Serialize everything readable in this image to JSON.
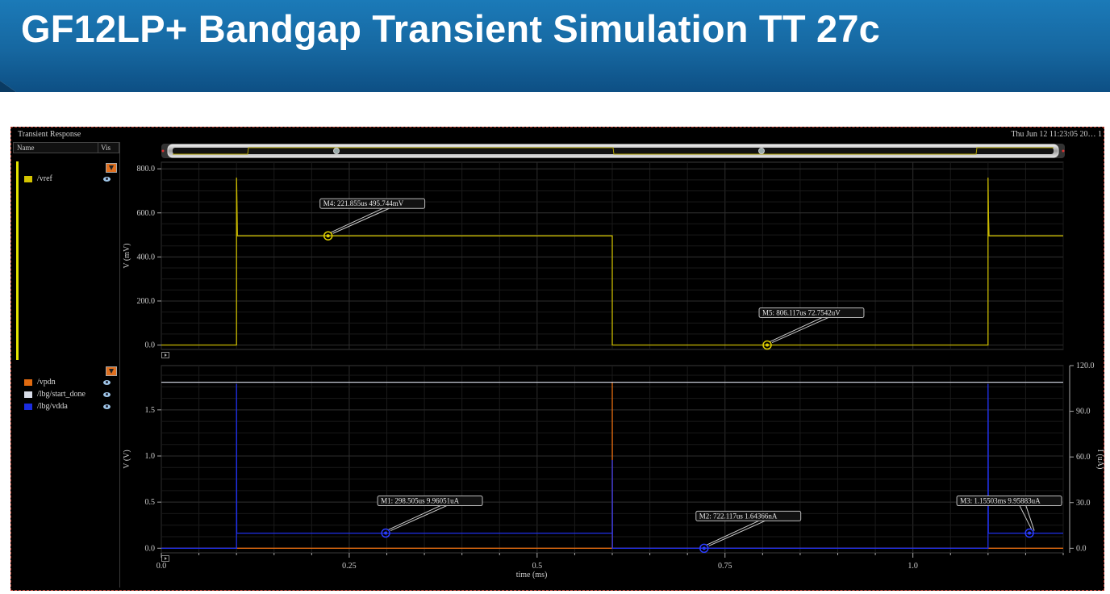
{
  "slide": {
    "title": "GF12LP+ Bandgap Transient Simulation TT 27c",
    "banner_color": "#1a6fa8"
  },
  "window": {
    "title": "Transient Response",
    "datetime": "Thu Jun 12 11:23:05 20…  1",
    "legend_header": {
      "name": "Name",
      "vis": "Vis"
    }
  },
  "top_legend": [
    {
      "name": "/vref",
      "color": "#d4c400"
    }
  ],
  "bottom_legend": [
    {
      "name": "/vpdn",
      "color": "#e06a10"
    },
    {
      "name": "/lbg/start_done",
      "color": "#d8dce8"
    },
    {
      "name": "/lbg/vdda",
      "color": "#1a2ce0"
    }
  ],
  "chart_data": [
    {
      "type": "line",
      "title": "",
      "xlabel": "",
      "ylabel": "V (mV)",
      "xlim": [
        0,
        1.2
      ],
      "ylim": [
        -20,
        830
      ],
      "yticks": [
        0.0,
        200.0,
        400.0,
        600.0,
        800.0
      ],
      "ytick_labels": [
        "0.0",
        "200.0",
        "400.0",
        "600.0",
        "800.0"
      ],
      "grid": true,
      "series": [
        {
          "name": "/vref",
          "color": "#c8b800",
          "x": [
            0,
            0.1,
            0.1,
            0.1006,
            0.1012,
            0.6,
            0.6,
            1.1,
            1.1,
            1.1006,
            1.1012,
            1.2
          ],
          "y": [
            0,
            0,
            760,
            650,
            495.7,
            495.7,
            0,
            0,
            760,
            580,
            495.7,
            495.7
          ]
        }
      ],
      "markers": [
        {
          "label": "M4: 221.855us 495.744mV",
          "x": 0.221855,
          "y": 495.744
        },
        {
          "label": "M5: 806.117us 72.7542uV",
          "x": 0.806117,
          "y": 0.0728
        }
      ]
    },
    {
      "type": "line",
      "title": "",
      "xlabel": "time (ms)",
      "ylabel": "V (V)",
      "ylabel_right": "I (uA)",
      "xlim": [
        0,
        1.2
      ],
      "xticks": [
        0.0,
        0.25,
        0.5,
        0.75,
        1.0
      ],
      "xtick_labels": [
        "0.0",
        "0.25",
        "0.5",
        "0.75",
        "1.0"
      ],
      "ylim": [
        -0.05,
        1.98
      ],
      "yticks": [
        0.0,
        0.5,
        1.0,
        1.5
      ],
      "ytick_labels": [
        "0.0",
        "0.5",
        "1.0",
        "1.5"
      ],
      "ylim_right": [
        -3,
        120
      ],
      "yticks_right": [
        0.0,
        30.0,
        60.0,
        90.0,
        120.0
      ],
      "ytick_labels_right": [
        "0.0",
        "30.0",
        "60.0",
        "90.0",
        "120.0"
      ],
      "grid": true,
      "series": [
        {
          "name": "/vpdn",
          "axis": "left",
          "color": "#e06a10",
          "x": [
            0,
            0.6,
            0.6,
            0.6002,
            1.2
          ],
          "y": [
            0,
            0,
            1.8,
            0,
            0
          ]
        },
        {
          "name": "/lbg/start_done",
          "axis": "left",
          "color": "#c8ccd8",
          "x": [
            0,
            1.2
          ],
          "y": [
            1.8,
            1.8
          ]
        },
        {
          "name": "/lbg/vdda",
          "axis": "right",
          "color": "#2030e8",
          "x": [
            0,
            0.1,
            0.1,
            0.1002,
            0.1004,
            0.6,
            0.6,
            0.6002,
            1.1,
            1.1,
            1.1002,
            1.1004,
            1.2
          ],
          "y": [
            0,
            0,
            108,
            30,
            9.96,
            9.96,
            58,
            0,
            0,
            108,
            86,
            9.96,
            9.96
          ]
        }
      ],
      "markers": [
        {
          "label": "M1: 298.505us 9.96051uA",
          "x": 0.298505,
          "y": 9.96051,
          "axis": "right"
        },
        {
          "label": "M2: 722.117us 1.64366nA",
          "x": 0.722117,
          "y": 0.00164,
          "axis": "right"
        },
        {
          "label": "M3: 1.15503ms 9.95883uA",
          "x": 1.15503,
          "y": 9.95883,
          "axis": "right"
        }
      ]
    }
  ]
}
